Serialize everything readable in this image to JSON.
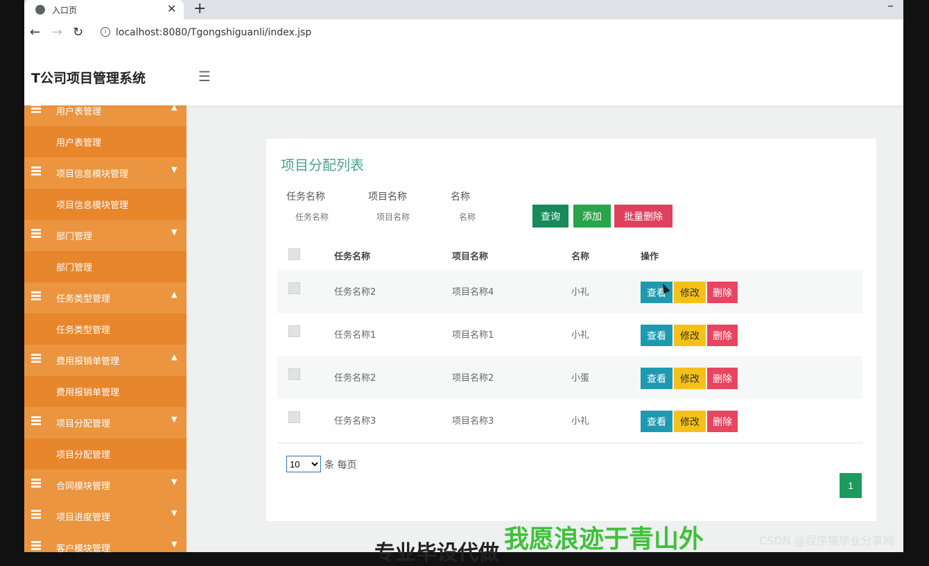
{
  "browser": {
    "tab_title": "入口页",
    "url": "localhost:8080/Tgongshiguanli/index.jsp"
  },
  "app": {
    "title": "T公司项目管理系统"
  },
  "sidebar": {
    "items": [
      {
        "type": "group",
        "label": "用户表管理",
        "caret": "▲"
      },
      {
        "type": "sub",
        "label": "用户表管理"
      },
      {
        "type": "group",
        "label": "项目信息模块管理",
        "caret": "▼"
      },
      {
        "type": "sub",
        "label": "项目信息模块管理"
      },
      {
        "type": "group",
        "label": "部门管理",
        "caret": "▼"
      },
      {
        "type": "sub",
        "label": "部门管理"
      },
      {
        "type": "group",
        "label": "任务类型管理",
        "caret": "▲"
      },
      {
        "type": "sub",
        "label": "任务类型管理"
      },
      {
        "type": "group",
        "label": "费用报销单管理",
        "caret": "▲"
      },
      {
        "type": "sub",
        "label": "费用报销单管理"
      },
      {
        "type": "group",
        "label": "项目分配管理",
        "caret": "▼"
      },
      {
        "type": "sub",
        "label": "项目分配管理"
      },
      {
        "type": "group",
        "label": "合同模块管理",
        "caret": "▼"
      },
      {
        "type": "group",
        "label": "项目进度管理",
        "caret": "▼"
      },
      {
        "type": "group",
        "label": "客户模块管理",
        "caret": "▼"
      }
    ]
  },
  "panel": {
    "title": "项目分配列表",
    "filters": [
      {
        "label": "任务名称",
        "placeholder": "任务名称"
      },
      {
        "label": "项目名称",
        "placeholder": "项目名称"
      },
      {
        "label": "名称",
        "placeholder": "名称"
      }
    ],
    "buttons": {
      "query": "查询",
      "add": "添加",
      "batch_delete": "批量删除"
    },
    "table": {
      "headers": [
        "任务名称",
        "项目名称",
        "名称",
        "操作"
      ],
      "rows": [
        {
          "task": "任务名称2",
          "project": "项目名称4",
          "name": "小礼"
        },
        {
          "task": "任务名称1",
          "project": "项目名称1",
          "name": "小礼"
        },
        {
          "task": "任务名称2",
          "project": "项目名称2",
          "name": "小蛋"
        },
        {
          "task": "任务名称3",
          "project": "项目名称3",
          "name": "小礼"
        }
      ],
      "actions": {
        "view": "查看",
        "edit": "修改",
        "delete": "删除"
      }
    },
    "pagination": {
      "page_size": "10",
      "per_page_label": "条 每页",
      "current_page": "1"
    }
  },
  "overlay": {
    "watermark_main": "专业毕设代做",
    "watermark_green": "我愿浪迹于青山外",
    "csdn": "CSDN @程序猿毕业分享网"
  }
}
